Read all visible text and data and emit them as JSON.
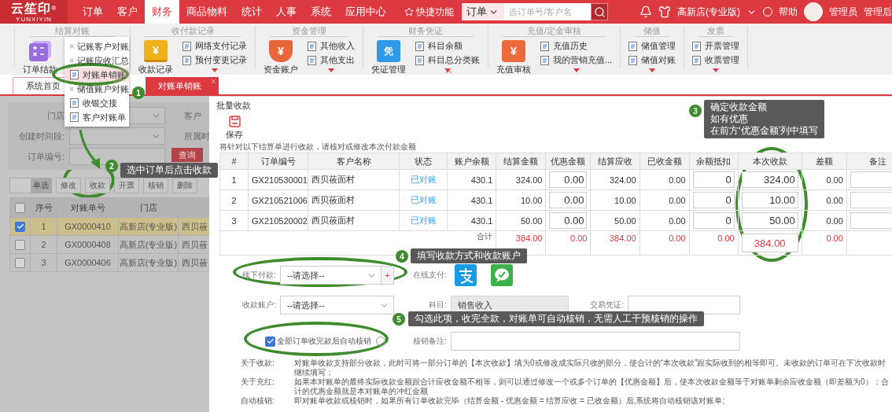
{
  "topbar": {
    "logo": "云笙印",
    "logo_mark": "®",
    "logo_sub": "YUNXIYIN",
    "nav": [
      {
        "label": "订单",
        "selected": false
      },
      {
        "label": "客户",
        "selected": false
      },
      {
        "label": "财务",
        "selected": true
      },
      {
        "label": "商品物料",
        "selected": false
      },
      {
        "label": "统计",
        "selected": false
      },
      {
        "label": "人事",
        "selected": false
      },
      {
        "label": "系统",
        "selected": false
      },
      {
        "label": "应用中心",
        "selected": false
      }
    ],
    "quick_access": "快捷功能",
    "search_scope": "订单",
    "search": {
      "placeholder": "选订单号/客户名"
    },
    "store": "高新店(专业版)",
    "help": "帮助",
    "user": "管理员",
    "admin": "管理后"
  },
  "ribbon": [
    {
      "title": "结算对账",
      "main": {
        "label": "订单结款"
      }
    },
    {
      "title": "收付款记录",
      "main": {
        "label": "收款记录",
        "glyph": "¥"
      },
      "items": [
        "网络支付记录",
        "预付变更记录"
      ],
      "more": true
    },
    {
      "title": "资金管理",
      "main": {
        "label": "资金账户",
        "glyph": "¥"
      },
      "items": [
        "其他收入",
        "其他支出"
      ],
      "more": true
    },
    {
      "title": "财务凭证",
      "main": {
        "label": "凭证管理",
        "glyph": "凭"
      },
      "items": [
        "科目余额",
        "科目总分类账"
      ],
      "more": true
    },
    {
      "title": "充值/定金审核",
      "main": {
        "label": "充值审核",
        "glyph": "¥"
      },
      "items": [
        "充值历史",
        "我的营销充值..."
      ],
      "more": true
    },
    {
      "title": "储值",
      "items": [
        "储值管理",
        "储值对账"
      ],
      "more": true
    },
    {
      "title": "发票",
      "items": [
        "开票管理",
        "收票管理"
      ],
      "more": true
    }
  ],
  "menu": [
    {
      "label": "记账客户对账",
      "selected": false
    },
    {
      "label": "记账应收汇总",
      "selected": false
    },
    {
      "label": "对账单销账",
      "selected": true
    },
    {
      "label": "储值账户对账",
      "selected": false
    },
    {
      "label": "收银交接",
      "selected": false
    },
    {
      "label": "客户对账单",
      "selected": false
    }
  ],
  "tabs": [
    {
      "label": "系统首页",
      "selected": false,
      "closable": false
    },
    {
      "label": "对账单销账",
      "selected": true,
      "closable": true
    }
  ],
  "list": {
    "filters": [
      {
        "label": "门店",
        "kind": "select"
      },
      {
        "label": "客户",
        "kind": "label"
      },
      {
        "label": "创建时间段:",
        "kind": "select"
      },
      {
        "label": "所属时",
        "kind": "label"
      },
      {
        "label": "订单编号:",
        "kind": "input"
      }
    ],
    "query": "查询",
    "mode": "单选",
    "actions": [
      "修改",
      "收款",
      "开票",
      "核销",
      "删除"
    ],
    "all_checked": false,
    "columns": [
      "序号",
      "对账单号",
      "门店"
    ],
    "rows": [
      {
        "no": "1",
        "code": "GX0000410",
        "store": "高新店(专业版)",
        "customer": "西贝莜",
        "checked": true
      },
      {
        "no": "2",
        "code": "GX0000408",
        "store": "高新店(专业版)",
        "customer": "西贝莜",
        "checked": false
      },
      {
        "no": "3",
        "code": "GX0000406",
        "store": "高新店(专业版)",
        "customer": "西贝莜",
        "checked": false
      }
    ]
  },
  "dialog": {
    "title": "批量收款",
    "save": "保存",
    "note": "将针对以下结算单进行收款，请核对或修改本次付款金额",
    "columns": [
      "#",
      "订单编号",
      "客户名称",
      "状态",
      "账户余额",
      "结算金额",
      "优惠金额",
      "结算应收",
      "已收金额",
      "余额抵扣",
      "本次收款",
      "差额",
      "备注"
    ],
    "rows": [
      {
        "index": "1",
        "order": "GX210530001",
        "customer": "西贝莜面村",
        "status": "已对账",
        "balance": "430.1",
        "amount": "324.00",
        "discount": "0.00",
        "receivable": "324.00",
        "received": "0.00",
        "deduction": "0",
        "payment": "324.00",
        "difference": "0.00"
      },
      {
        "index": "2",
        "order": "GX210521006",
        "customer": "西贝莜面村",
        "status": "已对账",
        "balance": "430.1",
        "amount": "10.00",
        "discount": "0.00",
        "receivable": "10.00",
        "received": "0.00",
        "deduction": "0",
        "payment": "10.00",
        "difference": "0.00"
      },
      {
        "index": "3",
        "order": "GX210520002",
        "customer": "西贝莜面村",
        "status": "已对账",
        "balance": "430.1",
        "amount": "50.00",
        "discount": "0.00",
        "receivable": "50.00",
        "received": "0.00",
        "deduction": "0",
        "payment": "50.00",
        "difference": "0.00"
      }
    ],
    "total": {
      "label": "合计",
      "amount": "384.00",
      "discount": "0.00",
      "receivable": "384.00",
      "received": "0.00",
      "deduction": "0.00",
      "payment": "384.00",
      "difference": "0.00"
    },
    "offline": {
      "label": "线下付款:",
      "value": "--请选择--",
      "add": "+"
    },
    "online": {
      "label": "在线支付:"
    },
    "account": {
      "label": "收款账户:",
      "value": "--请选择--"
    },
    "subject": {
      "label": "科目:",
      "value": "销售收入"
    },
    "voucher": {
      "label": "交易凭证:"
    },
    "auto": {
      "label": "全部订单收完款后自动核销",
      "checked": true
    },
    "remark": {
      "label": "核销备注:"
    },
    "notes": [
      {
        "label": "关于收款:",
        "text": "对账单收款支持部分收款，此时可将一部分订单的【本次收款】填为0或修改成实际只收的部分，使合计的“本次收款”跟实际收到的相等即可。未收款的订单可在下次收款时继续填写；"
      },
      {
        "label": "关于充红:",
        "text": "如果本对账单的最终实际收款金额跟合计应收金额不相等，则可以通过修改一个或多个订单的【优惠金额】后，使本次收款金额等于对账单剩余应收金额（即差额为0）；合计的优惠金额就是本对账单的冲红金额"
      },
      {
        "label": "自动核销:",
        "text": "即对账单收款或核销时，如果所有订单收款完毕（结算金额 - 优惠金额 = 结算应收 = 已收金额）后,系统将自动核销该对账单;"
      }
    ]
  },
  "annotations": [
    {
      "number": "1"
    },
    {
      "number": "2",
      "lines": [
        "选中订单后点击收款"
      ]
    },
    {
      "number": "3",
      "lines": [
        "确定收款金额",
        "如有优惠",
        "在前方‘优惠金额’列中填写"
      ]
    },
    {
      "number": "4",
      "lines": [
        "填写收款方式和收款账户"
      ]
    },
    {
      "number": "5",
      "lines": [
        "勾选此项，收完全款，对账单可自动核销，无需人工干预核销的操作"
      ]
    }
  ]
}
